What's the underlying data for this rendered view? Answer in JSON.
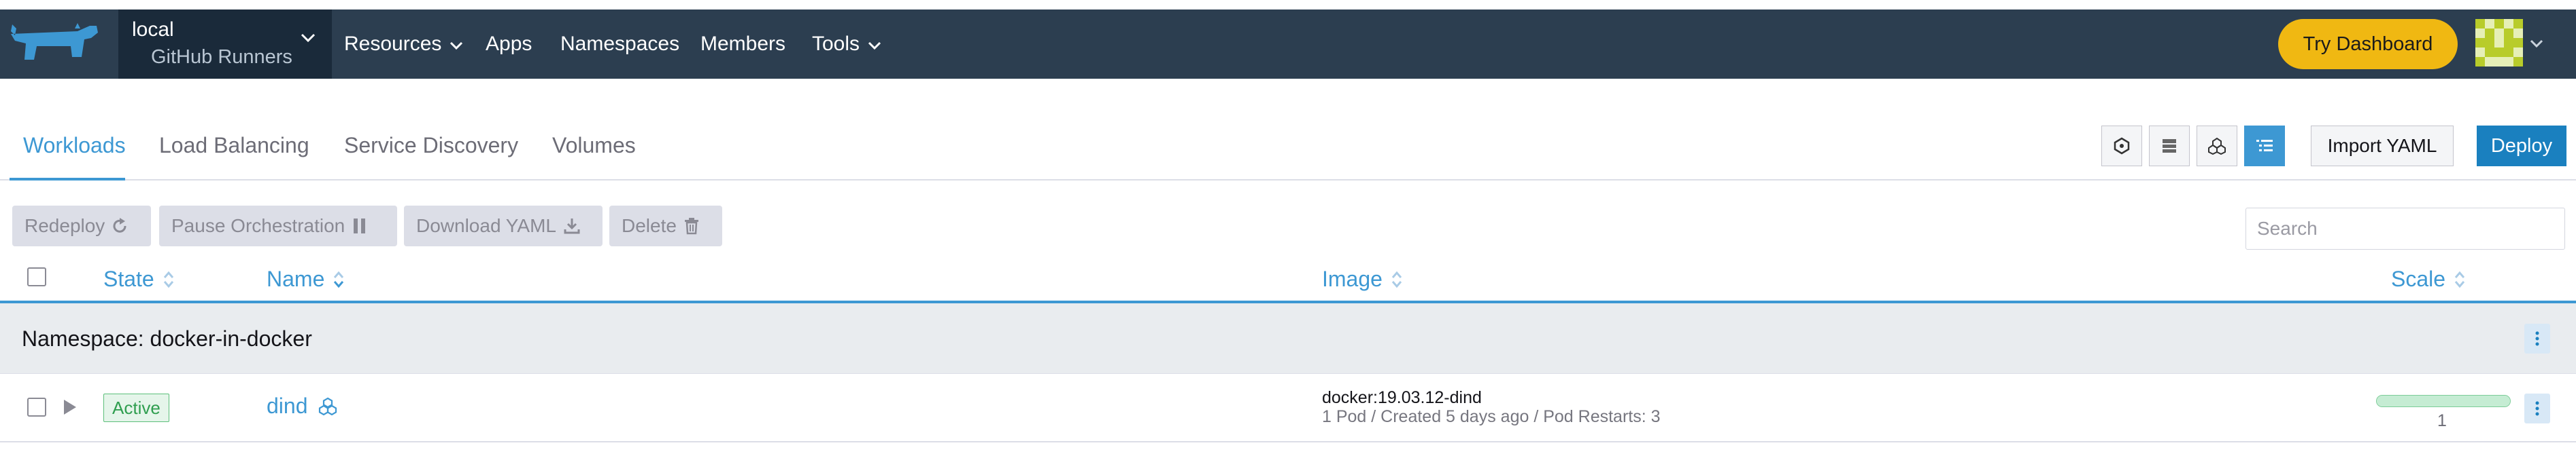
{
  "header": {
    "cluster": {
      "name": "local",
      "project": "GitHub Runners"
    },
    "menu": [
      {
        "label": "Resources",
        "has_dropdown": true
      },
      {
        "label": "Apps",
        "has_dropdown": false
      },
      {
        "label": "Namespaces",
        "has_dropdown": false
      },
      {
        "label": "Members",
        "has_dropdown": false
      },
      {
        "label": "Tools",
        "has_dropdown": true
      }
    ],
    "try_dashboard_label": "Try Dashboard",
    "colors": {
      "bar": "#2c3e50",
      "cluster_bg": "#1a2a3a",
      "accent_button": "#f0b812",
      "logo": "#3d98d3"
    }
  },
  "tabs": [
    {
      "label": "Workloads",
      "active": true
    },
    {
      "label": "Load Balancing",
      "active": false
    },
    {
      "label": "Service Discovery",
      "active": false
    },
    {
      "label": "Volumes",
      "active": false
    }
  ],
  "view_toggles": [
    {
      "icon": "node-icon",
      "active": false
    },
    {
      "icon": "table-icon",
      "active": false
    },
    {
      "icon": "group-icon",
      "active": false
    },
    {
      "icon": "list-icon",
      "active": true
    }
  ],
  "actions": {
    "import_yaml": "Import YAML",
    "deploy": "Deploy"
  },
  "bulk_actions": [
    {
      "label": "Redeploy",
      "icon": "redo-icon"
    },
    {
      "label": "Pause Orchestration",
      "icon": "pause-icon"
    },
    {
      "label": "Download YAML",
      "icon": "download-icon"
    },
    {
      "label": "Delete",
      "icon": "trash-icon"
    }
  ],
  "search": {
    "placeholder": "Search",
    "value": ""
  },
  "table": {
    "columns": [
      {
        "label": "State",
        "sort": "none"
      },
      {
        "label": "Name",
        "sort": "descending"
      },
      {
        "label": "Image",
        "sort": "none"
      },
      {
        "label": "Scale",
        "sort": "none"
      }
    ],
    "groups": [
      {
        "label": "Namespace: docker-in-docker",
        "rows": [
          {
            "state": "Active",
            "name": "dind",
            "image": "docker:19.03.12-dind",
            "details": "1 Pod / Created 5 days ago / Pod Restarts: 3",
            "scale": "1",
            "scale_fill": 1.0
          }
        ]
      }
    ]
  },
  "accent_color": "#3d98d3",
  "status_colors": {
    "active_text": "#2f9e4f",
    "active_bg": "#e5f5ea"
  }
}
